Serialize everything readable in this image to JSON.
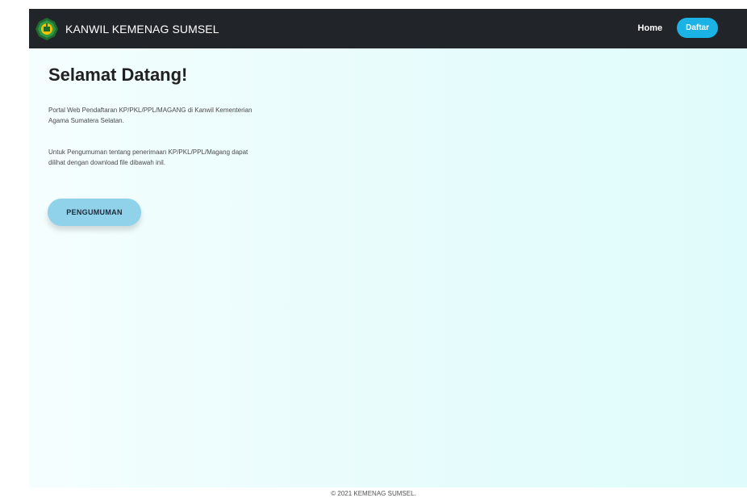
{
  "navbar": {
    "brand": "KANWIL KEMENAG SUMSEL",
    "logo_icon": "kemenag-logo-icon",
    "links": {
      "home": "Home",
      "daftar": "Daftar"
    }
  },
  "hero": {
    "title": "Selamat Datang!",
    "paragraph_1": "Portal Web Pendaftaran KP/PKL/PPL/MAGANG di Kanwil Kementerian Agama Sumatera Selatan.",
    "paragraph_2": "Untuk Pengumuman tentang penerimaan KP/PKL/PPL/Magang dapat dilihat dengan download file dibawah inil.",
    "button": "PENGUMUMAN"
  },
  "footer": {
    "copyright": "© 2021 KEMENAG SUMSEL."
  },
  "colors": {
    "navbar_bg": "#212529",
    "daftar_button": "#1bb3e6",
    "pengumuman_button": "#8fd2ea",
    "hero_bg": "#e6fcfc"
  }
}
